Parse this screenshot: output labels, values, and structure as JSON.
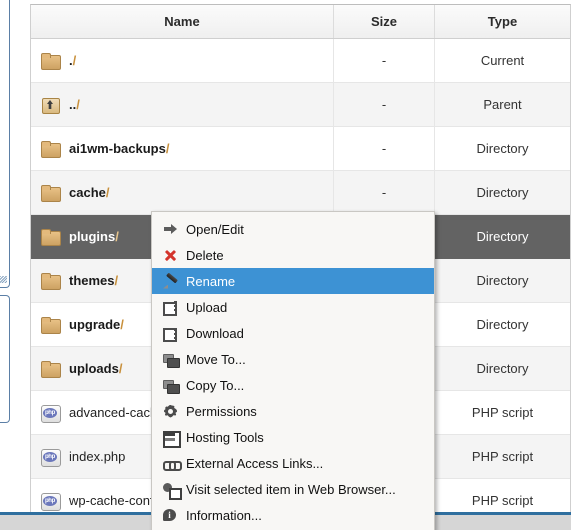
{
  "table": {
    "columns": [
      {
        "key": "name",
        "label": "Name"
      },
      {
        "key": "size",
        "label": "Size"
      },
      {
        "key": "type",
        "label": "Type"
      }
    ],
    "rows": [
      {
        "icon": "folder-icon",
        "name": ".",
        "slash": "/",
        "size": "-",
        "type": "Current",
        "selected": false
      },
      {
        "icon": "parent-folder-icon",
        "name": "..",
        "slash": "/",
        "size": "-",
        "type": "Parent",
        "selected": false
      },
      {
        "icon": "folder-icon",
        "name": "ai1wm-backups",
        "slash": "/",
        "size": "-",
        "type": "Directory",
        "selected": false
      },
      {
        "icon": "folder-icon",
        "name": "cache",
        "slash": "/",
        "size": "-",
        "type": "Directory",
        "selected": false
      },
      {
        "icon": "folder-icon",
        "name": "plugins",
        "slash": "/",
        "size": "",
        "type": "Directory",
        "selected": true
      },
      {
        "icon": "folder-icon",
        "name": "themes",
        "slash": "/",
        "size": "",
        "type": "Directory",
        "selected": false
      },
      {
        "icon": "folder-icon",
        "name": "upgrade",
        "slash": "/",
        "size": "",
        "type": "Directory",
        "selected": false
      },
      {
        "icon": "folder-icon",
        "name": "uploads",
        "slash": "/",
        "size": "",
        "type": "Directory",
        "selected": false
      },
      {
        "icon": "php-file-icon",
        "name": "advanced-cache",
        "slash": "",
        "size": "",
        "type": "PHP script",
        "selected": false
      },
      {
        "icon": "php-file-icon",
        "name": "index.php",
        "slash": "",
        "size": "",
        "type": "PHP script",
        "selected": false
      },
      {
        "icon": "php-file-icon",
        "name": "wp-cache-confi",
        "slash": "",
        "size": "",
        "type": "PHP script",
        "selected": false
      }
    ]
  },
  "context_menu": {
    "items": [
      {
        "icon": "arrow-right-icon",
        "label": "Open/Edit",
        "active": false
      },
      {
        "icon": "red-x-icon",
        "label": "Delete",
        "active": false
      },
      {
        "icon": "pencil-icon",
        "label": "Rename",
        "active": true
      },
      {
        "icon": "upload-icon",
        "label": "Upload",
        "active": false
      },
      {
        "icon": "download-icon",
        "label": "Download",
        "active": false
      },
      {
        "icon": "move-folder-icon",
        "label": "Move To...",
        "active": false
      },
      {
        "icon": "copy-folder-icon",
        "label": "Copy To...",
        "active": false
      },
      {
        "icon": "gear-icon",
        "label": "Permissions",
        "active": false
      },
      {
        "icon": "calendar-icon",
        "label": "Hosting Tools",
        "active": false
      },
      {
        "icon": "link-icon",
        "label": "External Access Links...",
        "active": false
      },
      {
        "icon": "web-browser-icon",
        "label": "Visit selected item in Web Browser...",
        "active": false
      },
      {
        "icon": "info-icon",
        "label": "Information...",
        "active": false
      }
    ]
  },
  "colors": {
    "selection_row": "#636363",
    "menu_highlight": "#3d92d4",
    "slash_accent": "#c8903c",
    "bottom_rule": "#2f6f9f",
    "panel_border": "#5b7fa6"
  }
}
